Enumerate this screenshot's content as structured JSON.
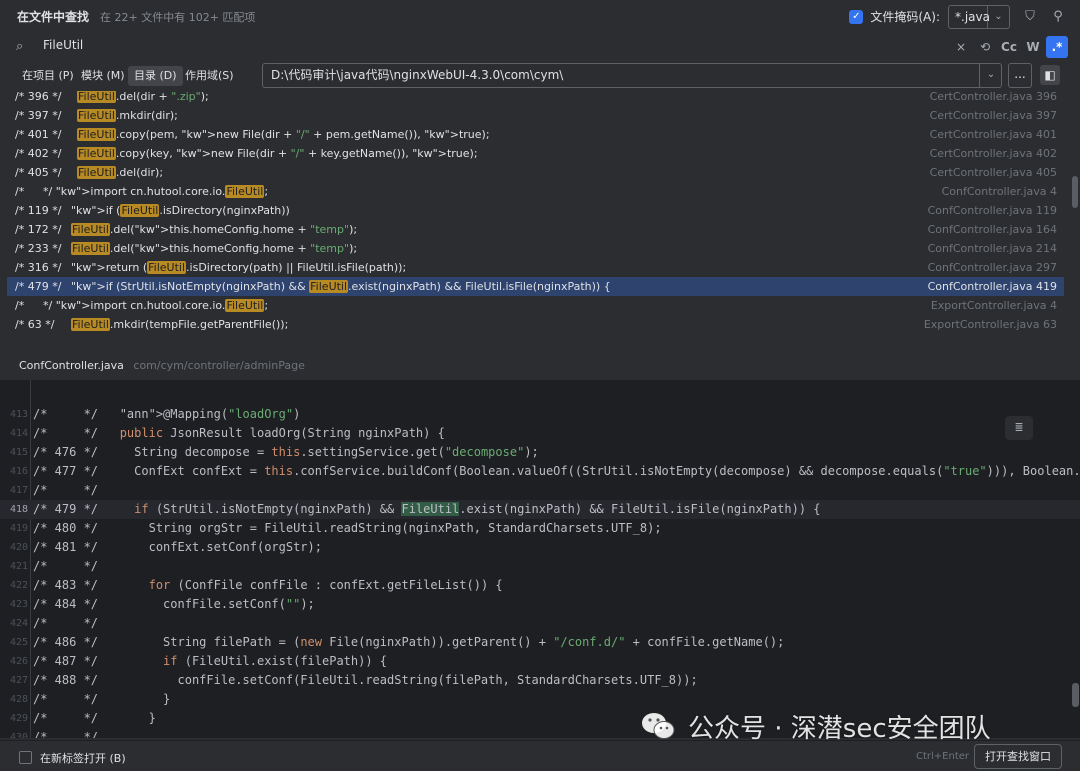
{
  "header": {
    "title": "在文件中查找",
    "subtitle": "在 22+ 文件中有 102+ 匹配项",
    "file_mask_label": "文件掩码(A):",
    "file_mask_value": "*.java"
  },
  "search": {
    "query": "FileUtil",
    "tools": [
      "Cc",
      "W",
      ".*"
    ]
  },
  "scope": {
    "tabs": [
      "在项目 (P)",
      "模块 (M)",
      "目录 (D)",
      "作用域(S)"
    ],
    "active_tab": "目录 (D)",
    "directory": "D:\\代码审计\\java代码\\nginxWebUI-4.3.0\\com\\cym\\",
    "browse": "..."
  },
  "results": [
    {
      "ln": "/* 396 */",
      "code": "FileUtil.del(dir + \".zip\");",
      "file": "CertController.java 396"
    },
    {
      "ln": "/* 397 */",
      "code": "FileUtil.mkdir(dir);",
      "file": "CertController.java 397"
    },
    {
      "ln": "/* 401 */",
      "code": "FileUtil.copy(pem, new File(dir + \"/\" + pem.getName()), true);",
      "file": "CertController.java 401"
    },
    {
      "ln": "/* 402 */",
      "code": "FileUtil.copy(key, new File(dir + \"/\" + key.getName()), true);",
      "file": "CertController.java 402"
    },
    {
      "ln": "/* 405 */",
      "code": "FileUtil.del(dir);",
      "file": "CertController.java 405"
    },
    {
      "ln": "/*",
      "code": "*/ import cn.hutool.core.io.FileUtil;",
      "file": "ConfController.java 4"
    },
    {
      "ln": "/* 119 */",
      "code": "if (FileUtil.isDirectory(nginxPath))",
      "file": "ConfController.java 119"
    },
    {
      "ln": "/* 172 */",
      "code": "FileUtil.del(this.homeConfig.home + \"temp\");",
      "file": "ConfController.java 164"
    },
    {
      "ln": "/* 233 */",
      "code": "FileUtil.del(this.homeConfig.home + \"temp\");",
      "file": "ConfController.java 214"
    },
    {
      "ln": "/* 316 */",
      "code": "return (FileUtil.isDirectory(path) || FileUtil.isFile(path));",
      "file": "ConfController.java 297"
    },
    {
      "ln": "/* 479 */",
      "code": "if (StrUtil.isNotEmpty(nginxPath) && FileUtil.exist(nginxPath) && FileUtil.isFile(nginxPath)) {",
      "file": "ConfController.java 419"
    },
    {
      "ln": "/*",
      "code": "*/ import cn.hutool.core.io.FileUtil;",
      "file": "ExportController.java 4"
    },
    {
      "ln": "/* 63 */",
      "code": "FileUtil.mkdir(tempFile.getParentFile());",
      "file": "ExportController.java 63"
    }
  ],
  "preview": {
    "file": "ConfController.java",
    "path": "com/cym/controller/adminPage"
  },
  "editor": {
    "lines": [
      {
        "n": "413",
        "code": "/*     */   @Mapping(\"loadOrg\")"
      },
      {
        "n": "414",
        "code": "/*     */   public JsonResult loadOrg(String nginxPath) {"
      },
      {
        "n": "415",
        "code": "/* 476 */     String decompose = this.settingService.get(\"decompose\");"
      },
      {
        "n": "416",
        "code": "/* 477 */     ConfExt confExt = this.confService.buildConf(Boolean.valueOf((StrUtil.isNotEmpty(decompose) && decompose.equals(\"true\"))), Boolean.valueOf"
      },
      {
        "n": "417",
        "code": "/*     */"
      },
      {
        "n": "418",
        "code": "/* 479 */     if (StrUtil.isNotEmpty(nginxPath) && FileUtil.exist(nginxPath) && FileUtil.isFile(nginxPath)) {"
      },
      {
        "n": "419",
        "code": "/* 480 */       String orgStr = FileUtil.readString(nginxPath, StandardCharsets.UTF_8);"
      },
      {
        "n": "420",
        "code": "/* 481 */       confExt.setConf(orgStr);"
      },
      {
        "n": "421",
        "code": "/*     */"
      },
      {
        "n": "422",
        "code": "/* 483 */       for (ConfFile confFile : confExt.getFileList()) {"
      },
      {
        "n": "423",
        "code": "/* 484 */         confFile.setConf(\"\");"
      },
      {
        "n": "424",
        "code": "/*     */"
      },
      {
        "n": "425",
        "code": "/* 486 */         String filePath = (new File(nginxPath)).getParent() + \"/conf.d/\" + confFile.getName();"
      },
      {
        "n": "426",
        "code": "/* 487 */         if (FileUtil.exist(filePath)) {"
      },
      {
        "n": "427",
        "code": "/* 488 */           confFile.setConf(FileUtil.readString(filePath, StandardCharsets.UTF_8));"
      },
      {
        "n": "428",
        "code": "/*     */         }"
      },
      {
        "n": "429",
        "code": "/*     */       }"
      },
      {
        "n": "430",
        "code": "/*     */"
      }
    ]
  },
  "footer": {
    "new_tab_label": "在新标签打开 (B)",
    "shortcut": "Ctrl+Enter",
    "open_button": "打开查找窗口"
  },
  "watermark": "公众号 · 深潜sec安全团队"
}
